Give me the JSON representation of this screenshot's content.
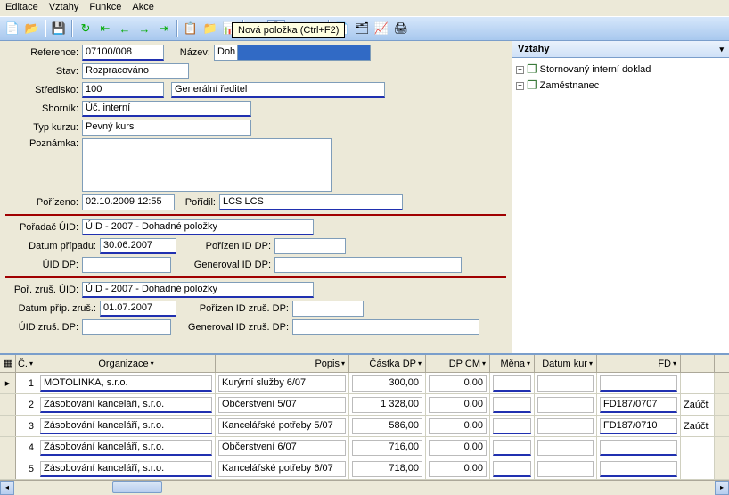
{
  "menu": {
    "editace": "Editace",
    "vztahy": "Vztahy",
    "funkce": "Funkce",
    "akce": "Akce"
  },
  "tooltip": "Nová položka (Ctrl+F2)",
  "form": {
    "reference_lbl": "Reference:",
    "reference": "07100/008",
    "nazev_lbl": "Název:",
    "nazev_pre": "Doh",
    "nazev_sel": "",
    "stav_lbl": "Stav:",
    "stav": "Rozpracováno",
    "stredisko_lbl": "Středisko:",
    "stredisko": "100",
    "stredisko_txt": "Generální ředitel",
    "sbornik_lbl": "Sborník:",
    "sbornik": "Úč. interní",
    "typkurzu_lbl": "Typ kurzu:",
    "typkurzu": "Pevný kurs",
    "poznamka_lbl": "Poznámka:",
    "porizeno_lbl": "Pořízeno:",
    "porizeno": "02.10.2009 12:55",
    "poridil_lbl": "Pořídil:",
    "poridil": "LCS LCS",
    "poradac_lbl": "Pořadač ÚID:",
    "poradac": "ÚID - 2007 - Dohadné položky",
    "datpr_lbl": "Datum případu:",
    "datpr": "30.06.2007",
    "porizen_lbl": "Pořízen ID DP:",
    "uiddp_lbl": "ÚID DP:",
    "gen_lbl": "Generoval ID DP:",
    "porzrus_lbl": "Poř. zruš. ÚID:",
    "porzrus": "ÚID - 2007 - Dohadné položky",
    "datzrus_lbl": "Datum příp. zruš.:",
    "datzrus": "01.07.2007",
    "porizrus_lbl": "Pořízen ID zruš. DP:",
    "uidzrus_lbl": "ÚID zruš. DP:",
    "genzrus_lbl": "Generoval ID zruš. DP:"
  },
  "side": {
    "title": "Vztahy",
    "item1": "Stornovaný interní doklad",
    "item2": "Zaměstnanec"
  },
  "grid": {
    "h_num": "Č.",
    "h_org": "Organizace",
    "h_popis": "Popis",
    "h_castka": "Částka DP",
    "h_dpcm": "DP CM",
    "h_mena": "Měna",
    "h_datk": "Datum kur",
    "h_fd": "FD",
    "rows": [
      {
        "n": "1",
        "org": "MOTOLINKA, s.r.o.",
        "popis": "Kurýrní služby 6/07",
        "castka": "300,00",
        "dpcm": "0,00",
        "fd": "",
        "zauct": ""
      },
      {
        "n": "2",
        "org": "Zásobování kanceláří, s.r.o.",
        "popis": "Občerstvení 5/07",
        "castka": "1 328,00",
        "dpcm": "0,00",
        "fd": "FD187/0707",
        "zauct": "Zaúčt"
      },
      {
        "n": "3",
        "org": "Zásobování kanceláří, s.r.o.",
        "popis": "Kancelářské potřeby 5/07",
        "castka": "586,00",
        "dpcm": "0,00",
        "fd": "FD187/0710",
        "zauct": "Zaúčt"
      },
      {
        "n": "4",
        "org": "Zásobování kanceláří, s.r.o.",
        "popis": "Občerstvení 6/07",
        "castka": "716,00",
        "dpcm": "0,00",
        "fd": "",
        "zauct": ""
      },
      {
        "n": "5",
        "org": "Zásobování kanceláří, s.r.o.",
        "popis": "Kancelářské potřeby 6/07",
        "castka": "718,00",
        "dpcm": "0,00",
        "fd": "",
        "zauct": ""
      }
    ]
  }
}
